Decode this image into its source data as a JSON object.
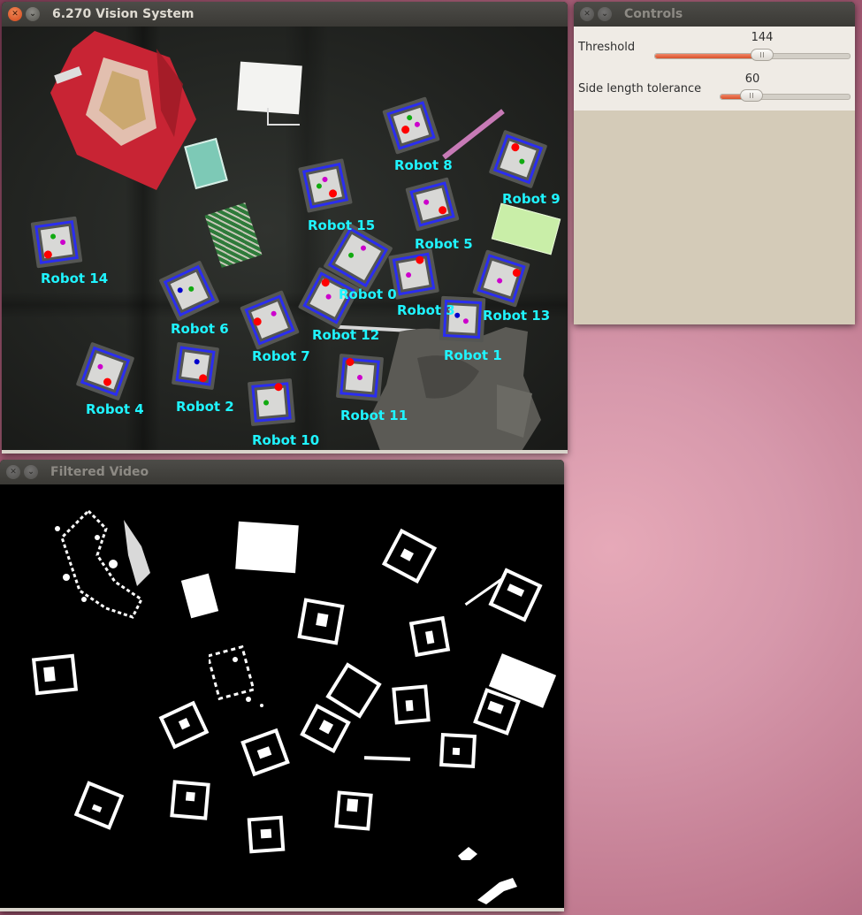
{
  "windows": {
    "vision": {
      "title": "6.270 Vision System"
    },
    "controls": {
      "title": "Controls"
    },
    "filtered": {
      "title": "Filtered Video"
    }
  },
  "controls": {
    "threshold": {
      "label": "Threshold",
      "value": "144",
      "fraction": 0.55
    },
    "side_tolerance": {
      "label": "Side length tolerance",
      "value": "60",
      "fraction": 0.24
    }
  },
  "robots": [
    "Robot 8",
    "Robot 9",
    "Robot 15",
    "Robot 5",
    "Robot 14",
    "Robot 0",
    "Robot 3",
    "Robot 13",
    "Robot 6",
    "Robot 12",
    "Robot 7",
    "Robot 1",
    "Robot 4",
    "Robot 2",
    "Robot 11",
    "Robot 10"
  ],
  "colors": {
    "label": "#1ff4ff",
    "marker_outline": "#2a2df0",
    "slider_fill": "#d9512a",
    "titlebar": "#3c3b37",
    "desktop": "#d698ab"
  },
  "icons": {
    "close": "close-icon",
    "minimize": "minimize-icon"
  }
}
